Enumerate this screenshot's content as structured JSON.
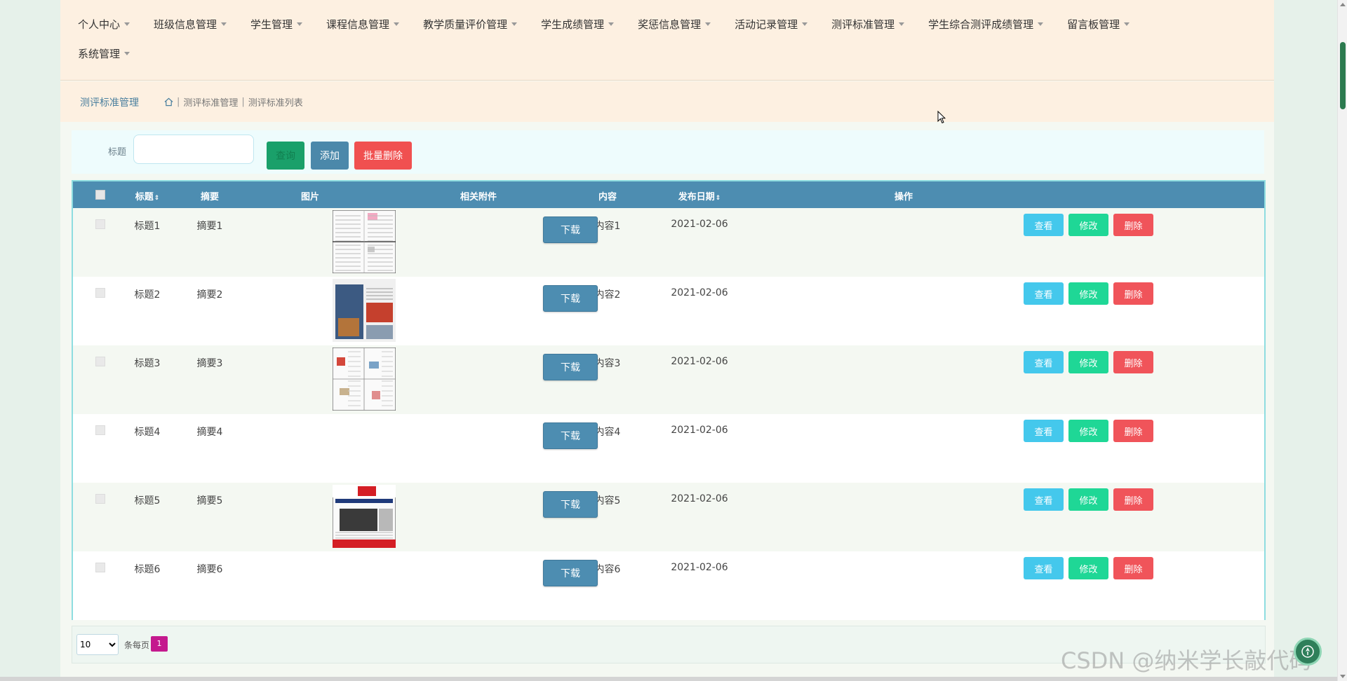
{
  "nav": {
    "row1": [
      "个人中心",
      "班级信息管理",
      "学生管理",
      "课程信息管理",
      "教学质量评价管理",
      "学生成绩管理",
      "奖惩信息管理",
      "活动记录管理",
      "测评标准管理",
      "学生综合测评成绩管理",
      "留言板管理"
    ],
    "row2": [
      "系统管理"
    ]
  },
  "breadcrumb": {
    "title": "测评标准管理",
    "items": [
      "测评标准管理",
      "测评标准列表"
    ]
  },
  "search": {
    "label": "标题",
    "value": "",
    "placeholder": "",
    "query_label": "查询",
    "add_label": "添加",
    "batch_delete_label": "批量删除"
  },
  "table": {
    "headers": {
      "title": "标题",
      "summary": "摘要",
      "image": "图片",
      "attachment": "相关附件",
      "content": "内容",
      "date": "发布日期",
      "actions": "操作"
    },
    "sort_glyph": "⇕",
    "rows": [
      {
        "title": "标题1",
        "summary": "摘要1",
        "download": "下载",
        "content": "内容1",
        "date": "2021-02-06",
        "thumb": "newspaper-grid"
      },
      {
        "title": "标题2",
        "summary": "摘要2",
        "download": "下载",
        "content": "内容2",
        "date": "2021-02-06",
        "thumb": "newspaper-photo"
      },
      {
        "title": "标题3",
        "summary": "摘要3",
        "download": "下载",
        "content": "内容3",
        "date": "2021-02-06",
        "thumb": "newspaper-spread"
      },
      {
        "title": "标题4",
        "summary": "摘要4",
        "download": "下载",
        "content": "内容4",
        "date": "2021-02-06",
        "thumb": "none"
      },
      {
        "title": "标题5",
        "summary": "摘要5",
        "download": "下载",
        "content": "内容5",
        "date": "2021-02-06",
        "thumb": "newspaper-red"
      },
      {
        "title": "标题6",
        "summary": "摘要6",
        "download": "下载",
        "content": "内容6",
        "date": "2021-02-06",
        "thumb": "none"
      }
    ],
    "actions": {
      "view": "查看",
      "edit": "修改",
      "delete": "删除"
    }
  },
  "pager": {
    "page_size": "10",
    "page_size_options": [
      "10"
    ],
    "per_page_label": "条每页",
    "current_page": "1"
  },
  "watermark": "CSDN @纳米学长敲代码",
  "colors": {
    "nav_bg": "#fdf0e1",
    "header_bg": "#4d8db1",
    "view": "#44c8ec",
    "edit": "#1fd796",
    "delete": "#f0545a",
    "page_active": "#c41a8e"
  }
}
